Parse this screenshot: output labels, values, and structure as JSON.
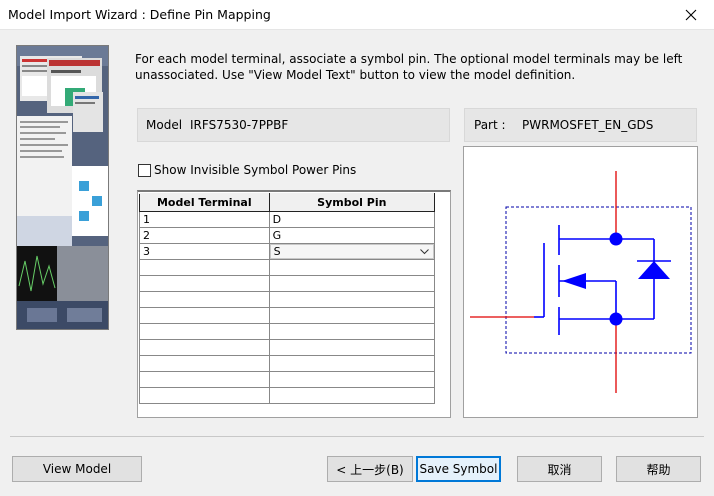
{
  "window": {
    "title": "Model Import Wizard : Define Pin Mapping"
  },
  "instructions": "For each model terminal, associate a symbol pin. The optional model terminals may be left unassociated. Use \"View Model Text\" button to view the model definition.",
  "model": {
    "label": "Model",
    "value": "IRFS7530-7PPBF"
  },
  "part": {
    "label": "Part :",
    "value": "PWRMOSFET_EN_GDS"
  },
  "show_invisible": {
    "label": "Show Invisible Symbol Power Pins",
    "checked": false
  },
  "grid": {
    "headers": [
      "Model Terminal",
      "Symbol Pin"
    ],
    "rows": [
      {
        "terminal": "1",
        "pin": "D"
      },
      {
        "terminal": "2",
        "pin": "G"
      },
      {
        "terminal": "3",
        "pin": "S"
      }
    ]
  },
  "symbol_colors": {
    "body": "#0000ff",
    "pins": "#e00000",
    "boundary": "#0000aa"
  },
  "buttons": {
    "view_model": "View Model",
    "back": "< 上一步(B)",
    "save_symbol": "Save Symbol",
    "cancel": "取消",
    "help": "帮助"
  }
}
